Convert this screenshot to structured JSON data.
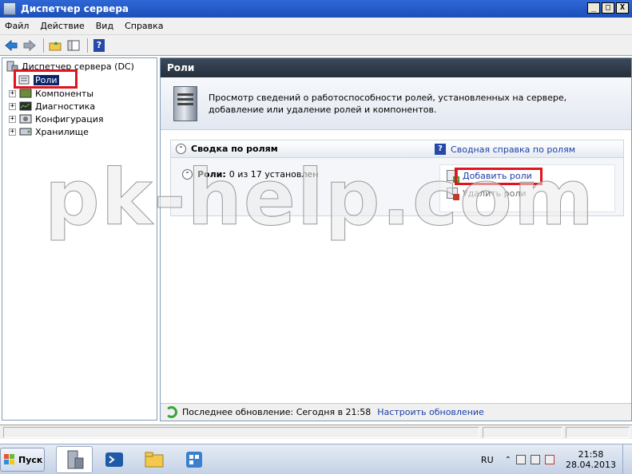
{
  "window": {
    "title": "Диспетчер сервера",
    "controls": {
      "minimize": "_",
      "maximize": "□",
      "close": "X"
    }
  },
  "menu": [
    "Файл",
    "Действие",
    "Вид",
    "Справка"
  ],
  "toolbar": {
    "icons": [
      "back-arrow-icon",
      "forward-arrow-icon",
      "up-folder-icon",
      "show-tree-icon",
      "help-icon"
    ],
    "help_glyph": "?"
  },
  "tree": {
    "root": "Диспетчер сервера (DC)",
    "selected": "Роли",
    "items": [
      "Компоненты",
      "Диагностика",
      "Конфигурация",
      "Хранилище"
    ],
    "expander": "+"
  },
  "right": {
    "header": "Роли",
    "intro": "Просмотр сведений о работоспособности ролей, установленных на сервере, добавление или удаление ролей и компонентов.",
    "summary": {
      "title": "Сводка по ролям",
      "help_link": "Сводная справка по ролям",
      "help_glyph": "?",
      "collapse_glyph": "⌃",
      "roles_label": "Роли:",
      "roles_value": "0 из 17 установлен",
      "actions": {
        "add": "Добавить роли",
        "remove": "Удалить роли"
      }
    },
    "refresh": {
      "text": "Последнее обновление: Сегодня в 21:58",
      "link": "Настроить обновление"
    }
  },
  "taskbar": {
    "start_label": "Пуск",
    "lang": "RU",
    "time": "21:58",
    "date": "28.04.2013",
    "tray_arrow": "⌃"
  },
  "watermark": "pk-help.com",
  "colors": {
    "highlight_red": "#e0141e",
    "link_blue": "#1a3fa8",
    "title_blue": "#2f67d7"
  }
}
